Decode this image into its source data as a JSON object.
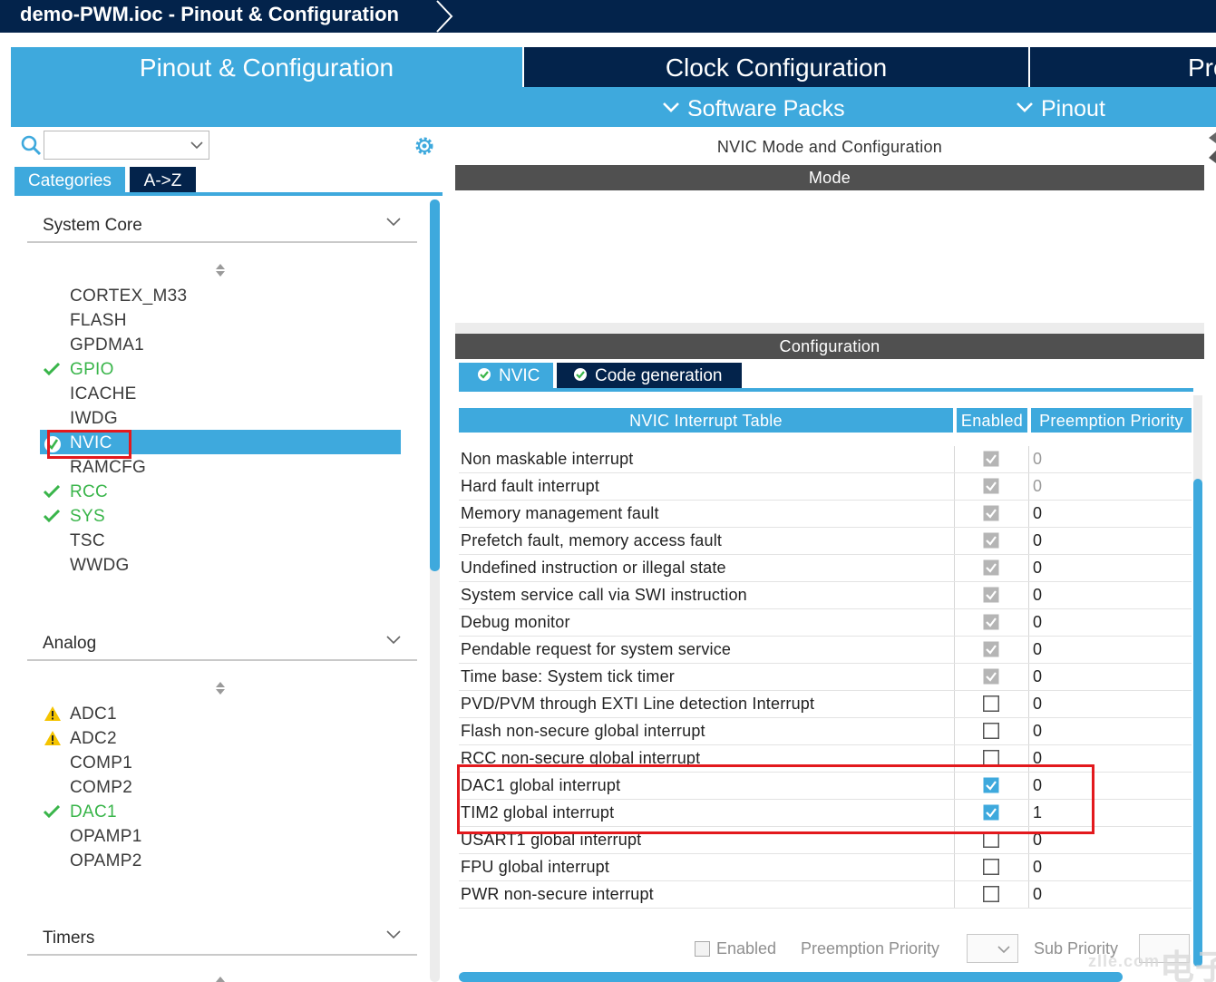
{
  "window": {
    "title": "demo-PWM.ioc - Pinout & Configuration"
  },
  "main_tabs": [
    {
      "label": "Pinout & Configuration",
      "active": true
    },
    {
      "label": "Clock Configuration",
      "active": false
    },
    {
      "label": "Pro",
      "active": false
    }
  ],
  "sub_menu": [
    {
      "label": "Software Packs",
      "icon": "chevron-down-icon"
    },
    {
      "label": "Pinout",
      "icon": "chevron-down-icon"
    }
  ],
  "left": {
    "search": {
      "value": "",
      "placeholder": ""
    },
    "tabs": [
      "Categories",
      "A->Z"
    ],
    "sections": [
      {
        "title": "System Core",
        "items": [
          {
            "label": "CORTEX_M33",
            "status": "none"
          },
          {
            "label": "FLASH",
            "status": "none"
          },
          {
            "label": "GPDMA1",
            "status": "none"
          },
          {
            "label": "GPIO",
            "status": "ok"
          },
          {
            "label": "ICACHE",
            "status": "none"
          },
          {
            "label": "IWDG",
            "status": "none"
          },
          {
            "label": "NVIC",
            "status": "ok",
            "selected": true
          },
          {
            "label": "RAMCFG",
            "status": "none"
          },
          {
            "label": "RCC",
            "status": "ok"
          },
          {
            "label": "SYS",
            "status": "ok"
          },
          {
            "label": "TSC",
            "status": "none"
          },
          {
            "label": "WWDG",
            "status": "none"
          }
        ]
      },
      {
        "title": "Analog",
        "items": [
          {
            "label": "ADC1",
            "status": "warning"
          },
          {
            "label": "ADC2",
            "status": "warning"
          },
          {
            "label": "COMP1",
            "status": "none"
          },
          {
            "label": "COMP2",
            "status": "none"
          },
          {
            "label": "DAC1",
            "status": "ok"
          },
          {
            "label": "OPAMP1",
            "status": "none"
          },
          {
            "label": "OPAMP2",
            "status": "none"
          }
        ]
      },
      {
        "title": "Timers",
        "items": []
      }
    ]
  },
  "right": {
    "title": "NVIC Mode and Configuration",
    "mode_header": "Mode",
    "config_header": "Configuration",
    "config_tabs": [
      {
        "label": "NVIC",
        "active": true,
        "icon": "check-circle-icon"
      },
      {
        "label": "Code generation",
        "active": false,
        "icon": "check-circle-icon"
      }
    ],
    "table": {
      "columns": [
        "NVIC Interrupt Table",
        "Enabled",
        "Preemption Priority"
      ],
      "rows": [
        {
          "name": "Non maskable interrupt",
          "enabled": true,
          "locked": true,
          "priority": "0"
        },
        {
          "name": "Hard fault interrupt",
          "enabled": true,
          "locked": true,
          "priority": "0"
        },
        {
          "name": "Memory management fault",
          "enabled": true,
          "locked": true,
          "priority": "0"
        },
        {
          "name": "Prefetch fault, memory access fault",
          "enabled": true,
          "locked": true,
          "priority": "0"
        },
        {
          "name": "Undefined instruction or illegal state",
          "enabled": true,
          "locked": true,
          "priority": "0"
        },
        {
          "name": "System service call via SWI instruction",
          "enabled": true,
          "locked": true,
          "priority": "0"
        },
        {
          "name": "Debug monitor",
          "enabled": true,
          "locked": true,
          "priority": "0"
        },
        {
          "name": "Pendable request for system service",
          "enabled": true,
          "locked": true,
          "priority": "0"
        },
        {
          "name": "Time base: System tick timer",
          "enabled": true,
          "locked": true,
          "priority": "0"
        },
        {
          "name": "PVD/PVM through EXTI Line detection Interrupt",
          "enabled": false,
          "locked": false,
          "priority": "0"
        },
        {
          "name": "Flash non-secure global interrupt",
          "enabled": false,
          "locked": false,
          "priority": "0"
        },
        {
          "name": "RCC non-secure global interrupt",
          "enabled": false,
          "locked": false,
          "priority": "0"
        },
        {
          "name": "DAC1 global interrupt",
          "enabled": true,
          "locked": false,
          "priority": "0"
        },
        {
          "name": "TIM2 global interrupt",
          "enabled": true,
          "locked": false,
          "priority": "1"
        },
        {
          "name": "USART1 global interrupt",
          "enabled": false,
          "locked": false,
          "priority": "0"
        },
        {
          "name": "FPU global interrupt",
          "enabled": false,
          "locked": false,
          "priority": "0"
        },
        {
          "name": "PWR non-secure interrupt",
          "enabled": false,
          "locked": false,
          "priority": "0"
        }
      ]
    },
    "bottom": {
      "enabled_label": "Enabled",
      "preemption_label": "Preemption Priority",
      "sub_priority_label": "Sub Priority"
    }
  },
  "watermark": {
    "text": "电子网",
    "sub": "zlle.com"
  },
  "colors": {
    "brand_dark": "#03234b",
    "accent": "#3ea9dd",
    "ok": "#39b54a",
    "warning": "#f5c400",
    "highlight": "#e3191d"
  }
}
